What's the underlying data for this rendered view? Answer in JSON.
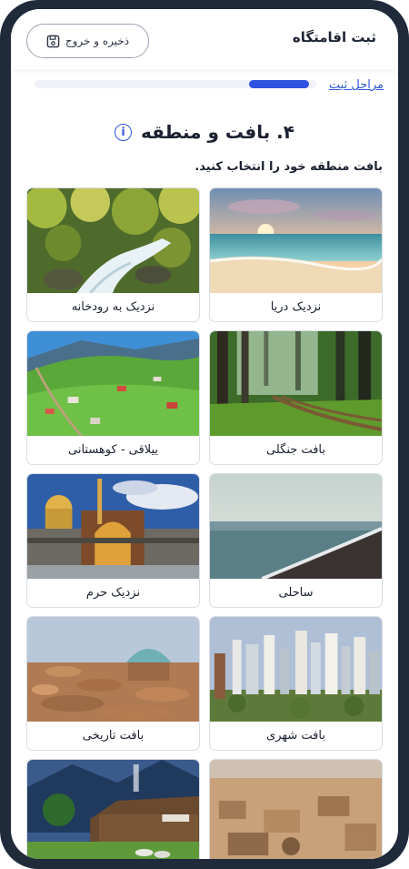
{
  "header": {
    "title": "ثبت اقامتگاه",
    "save_label": "ذخیره و خروج"
  },
  "steps": {
    "link_label": "مراحل ثبت",
    "progress": 0.2
  },
  "step": {
    "title": "۴. بافت و منطقه",
    "info_glyph": "i",
    "instruction": "بافت منطقه خود را انتخاب کنید."
  },
  "options": [
    {
      "label": "نزدیک دریا",
      "scene": "beach"
    },
    {
      "label": "نزدیک به رودخانه",
      "scene": "river"
    },
    {
      "label": "بافت جنگلی",
      "scene": "forest"
    },
    {
      "label": "ییلاقی - کوهستانی",
      "scene": "mountain-village"
    },
    {
      "label": "ساحلی",
      "scene": "coast"
    },
    {
      "label": "نزدیک حرم",
      "scene": "shrine"
    },
    {
      "label": "بافت شهری",
      "scene": "city"
    },
    {
      "label": "بافت تاریخی",
      "scene": "historic"
    },
    {
      "label": "",
      "scene": "desert"
    },
    {
      "label": "",
      "scene": "cottage"
    }
  ],
  "colors": {
    "accent": "#2f52e0",
    "frame": "#1f2a3b",
    "link": "#2d59d6"
  },
  "icons": {
    "save": "floppy-disk-icon",
    "info": "info-icon"
  }
}
